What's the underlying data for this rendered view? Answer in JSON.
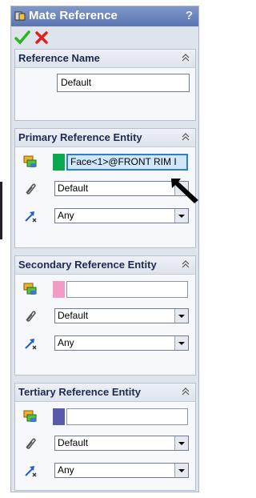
{
  "window": {
    "title": "Mate Reference",
    "help": "?"
  },
  "actions": {
    "ok": "OK",
    "cancel": "Cancel"
  },
  "reference_name": {
    "title": "Reference Name",
    "value": "Default"
  },
  "primary": {
    "title": "Primary Reference Entity",
    "selection": "Face<1>@FRONT RIM I",
    "swatch_color": "#0aa84f",
    "mate_type": "Default",
    "alignment": "Any"
  },
  "secondary": {
    "title": "Secondary Reference Entity",
    "selection": "",
    "swatch_color": "#f29bc4",
    "mate_type": "Default",
    "alignment": "Any"
  },
  "tertiary": {
    "title": "Tertiary Reference Entity",
    "selection": "",
    "swatch_color": "#5a5aa8",
    "mate_type": "Default",
    "alignment": "Any"
  }
}
